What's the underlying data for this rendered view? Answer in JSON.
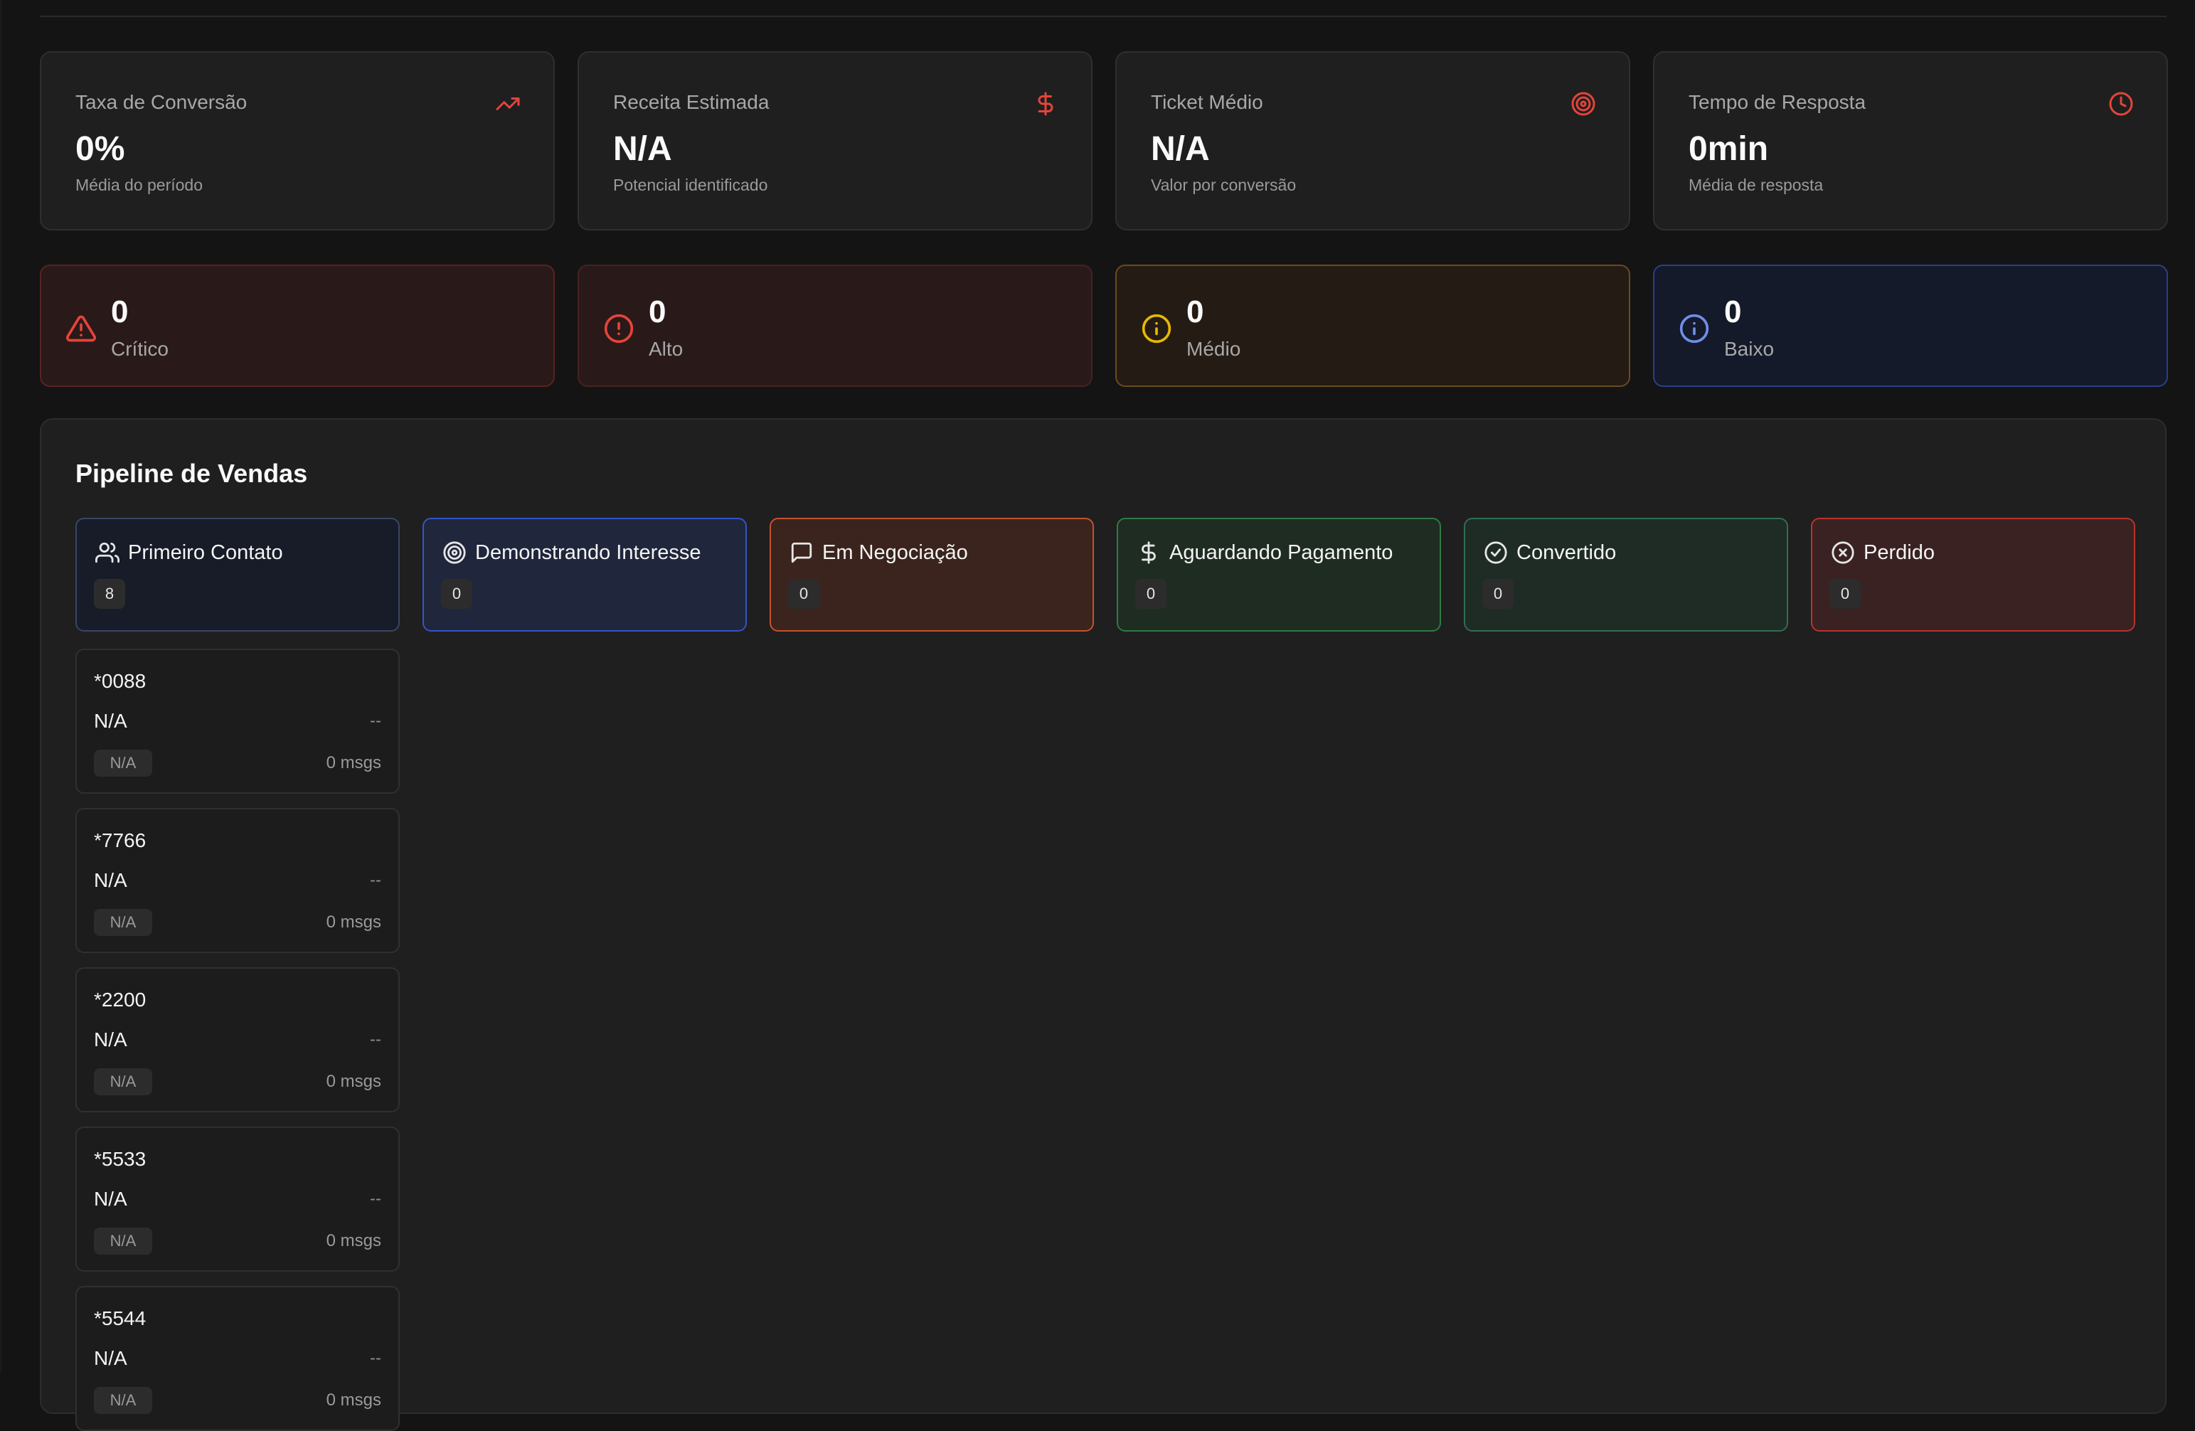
{
  "kpis": [
    {
      "label": "Taxa de Conversão",
      "value": "0%",
      "sub": "Média do período",
      "icon": "trending-up-icon"
    },
    {
      "label": "Receita Estimada",
      "value": "N/A",
      "sub": "Potencial identificado",
      "icon": "dollar-icon"
    },
    {
      "label": "Ticket Médio",
      "value": "N/A",
      "sub": "Valor por conversão",
      "icon": "target-icon"
    },
    {
      "label": "Tempo de Resposta",
      "value": "0min",
      "sub": "Média de resposta",
      "icon": "clock-icon"
    }
  ],
  "severity": [
    {
      "value": "0",
      "label": "Crítico",
      "icon": "alert-triangle-icon",
      "color": "#e5443a"
    },
    {
      "value": "0",
      "label": "Alto",
      "icon": "alert-circle-icon",
      "color": "#e5443a"
    },
    {
      "value": "0",
      "label": "Médio",
      "icon": "info-icon",
      "color": "#e6b800"
    },
    {
      "value": "0",
      "label": "Baixo",
      "icon": "info-icon",
      "color": "#6f8fe8"
    }
  ],
  "pipeline": {
    "title": "Pipeline de Vendas",
    "stages": [
      {
        "name": "Primeiro Contato",
        "count": "8",
        "icon": "users-icon"
      },
      {
        "name": "Demonstrando Interesse",
        "count": "0",
        "icon": "target-icon"
      },
      {
        "name": "Em Negociação",
        "count": "0",
        "icon": "message-square-icon"
      },
      {
        "name": "Aguardando Pagamento",
        "count": "0",
        "icon": "dollar-icon"
      },
      {
        "name": "Convertido",
        "count": "0",
        "icon": "check-circle-icon"
      },
      {
        "name": "Perdido",
        "count": "0",
        "icon": "x-circle-icon"
      }
    ],
    "leads": [
      {
        "id": "*0088",
        "name": "N/A",
        "time": "--",
        "tag": "N/A",
        "msgs": "0 msgs"
      },
      {
        "id": "*7766",
        "name": "N/A",
        "time": "--",
        "tag": "N/A",
        "msgs": "0 msgs"
      },
      {
        "id": "*2200",
        "name": "N/A",
        "time": "--",
        "tag": "N/A",
        "msgs": "0 msgs"
      },
      {
        "id": "*5533",
        "name": "N/A",
        "time": "--",
        "tag": "N/A",
        "msgs": "0 msgs"
      },
      {
        "id": "*5544",
        "name": "N/A",
        "time": "--",
        "tag": "N/A",
        "msgs": "0 msgs"
      }
    ]
  },
  "colors": {
    "accent_red": "#e5443a",
    "background": "#141414",
    "card": "#1f1f1f"
  }
}
